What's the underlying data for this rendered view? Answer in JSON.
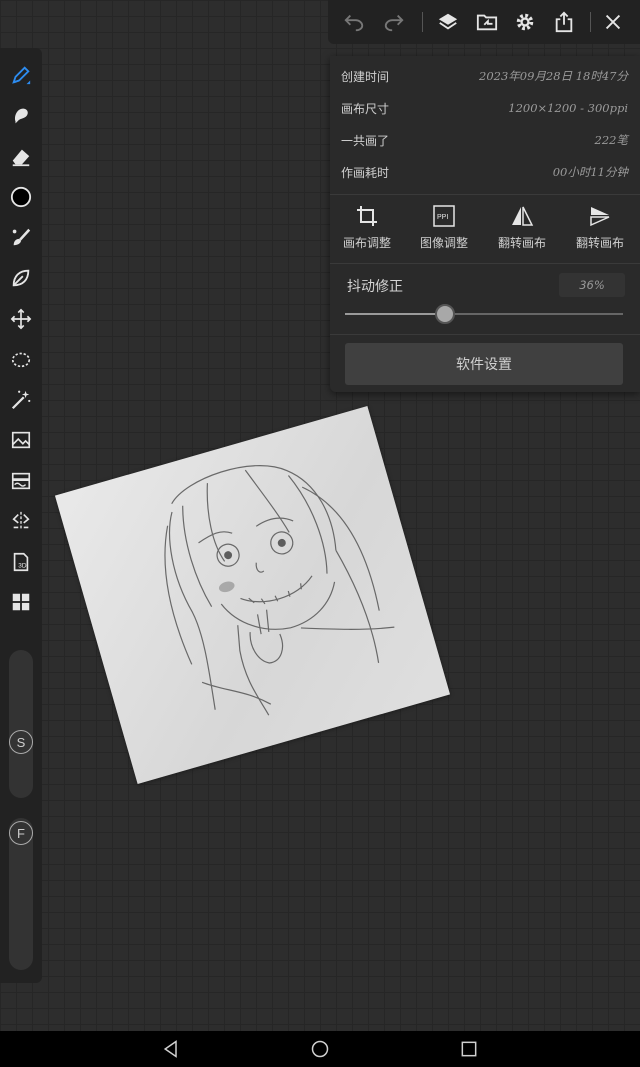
{
  "colors": {
    "accent": "#2d8cf0",
    "background": "#2d2d2d",
    "panel": "#2a2a2a",
    "toolbar": "#222222"
  },
  "left_toolbar": {
    "tools": [
      {
        "name": "brush-tool",
        "icon": "pen-icon",
        "active": true
      },
      {
        "name": "smudge-tool",
        "icon": "smudge-icon"
      },
      {
        "name": "eraser-tool",
        "icon": "eraser-icon"
      },
      {
        "name": "color-picker",
        "icon": "color-swatch-icon"
      },
      {
        "name": "brush-library",
        "icon": "brush-icon"
      },
      {
        "name": "fill-tool",
        "icon": "leaf-icon"
      },
      {
        "name": "transform-tool",
        "icon": "move-arrows-icon"
      },
      {
        "name": "lasso-select-tool",
        "icon": "lasso-icon"
      },
      {
        "name": "magic-wand-tool",
        "icon": "magic-wand-icon"
      },
      {
        "name": "import-image-tool",
        "icon": "image-import-icon"
      },
      {
        "name": "filter-tool",
        "icon": "filter-icon"
      },
      {
        "name": "symmetry-tool",
        "icon": "symmetry-icon"
      },
      {
        "name": "3d-tool",
        "icon": "3d-icon"
      },
      {
        "name": "more-tools",
        "icon": "grid-icon"
      }
    ],
    "size_slider_label": "S",
    "opacity_slider_label": "F"
  },
  "top_toolbar": {
    "icons": [
      "undo-icon",
      "redo-icon",
      "layers-icon",
      "export-folder-icon",
      "gear-icon",
      "share-icon",
      "close-icon"
    ]
  },
  "panel": {
    "info": [
      {
        "label": "创建时间",
        "value": "2023年09月28日 18时47分"
      },
      {
        "label": "画布尺寸",
        "value": "1200×1200 - 300ppi"
      },
      {
        "label": "一共画了",
        "value": "222笔"
      },
      {
        "label": "作画耗时",
        "value": "00小时11分钟"
      }
    ],
    "actions": [
      {
        "label": "画布调整",
        "icon": "crop-icon"
      },
      {
        "label": "图像调整",
        "icon": "ppi-icon"
      },
      {
        "label": "翻转画布",
        "icon": "flip-horizontal-icon"
      },
      {
        "label": "翻转画布",
        "icon": "flip-vertical-icon"
      }
    ],
    "stabilizer": {
      "label": "抖动修正",
      "value_text": "36%",
      "value": 0.36
    },
    "settings_button": "软件设置"
  },
  "navbar": {
    "icons": [
      "back-icon",
      "home-icon",
      "recents-icon"
    ]
  }
}
